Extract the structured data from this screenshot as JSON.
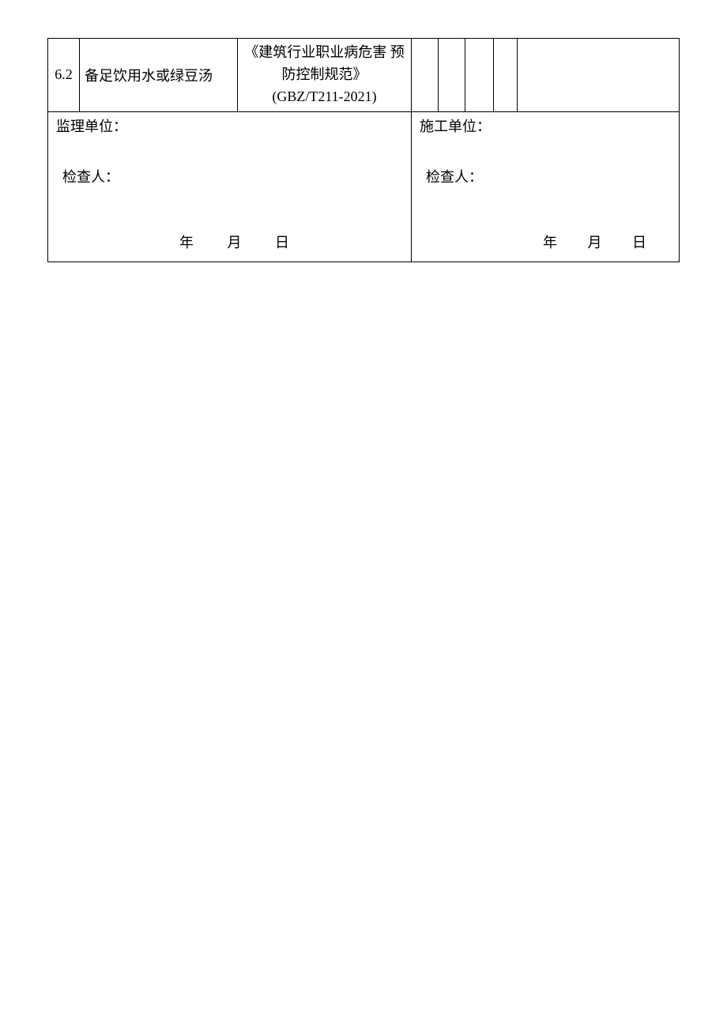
{
  "row": {
    "num": "6.2",
    "desc": "备足饮用水或绿豆汤",
    "standard_l1": "《建筑行业职业病危害 预",
    "standard_l2": "防控制规范》",
    "standard_l3": "(GBZ/T211-2021)"
  },
  "sign": {
    "left_unit": "监理单位：",
    "right_unit": "施工单位：",
    "inspector": "检查人：",
    "year": "年",
    "month": "月",
    "day": "日"
  }
}
